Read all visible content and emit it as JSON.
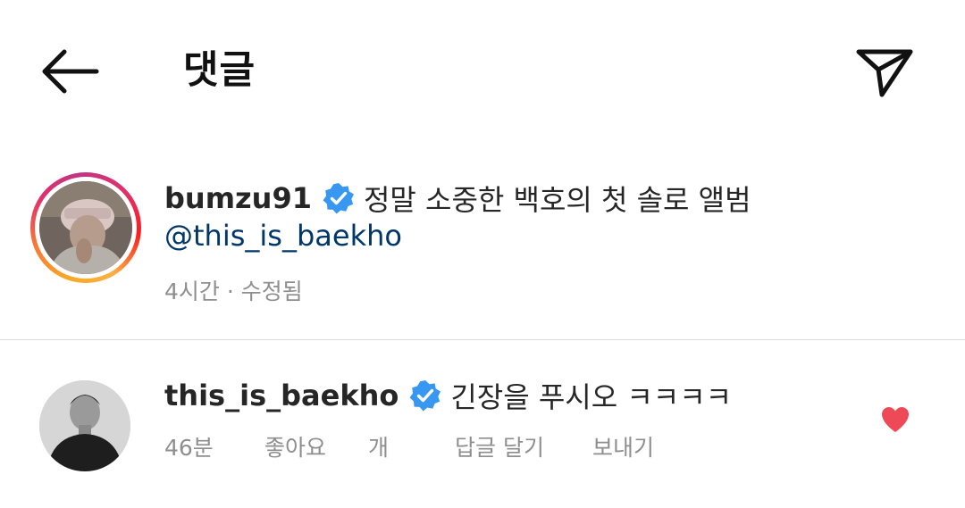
{
  "header": {
    "title": "댓글",
    "back_icon": "arrow-left-icon",
    "share_icon": "paper-plane-icon"
  },
  "caption": {
    "username": "bumzu91",
    "verified": true,
    "text": "정말 소중한 백호의 첫 솔로 앨범",
    "mention": "@this_is_baekho",
    "meta": "4시간 · 수정됨",
    "has_story_ring": true
  },
  "comment": {
    "username": "this_is_baekho",
    "verified": true,
    "text": "긴장을 푸시오 ㅋㅋㅋㅋ",
    "time": "46분",
    "likes_label": "좋아요",
    "likes_count_label": "개",
    "reply_label": "답글 달기",
    "send_label": "보내기",
    "liked": true
  },
  "colors": {
    "verified_blue": "#3897f0",
    "mention_blue": "#00376b",
    "heart_red": "#ed4956",
    "meta_gray": "#8e8e8e",
    "divider": "#dbdbdb"
  }
}
